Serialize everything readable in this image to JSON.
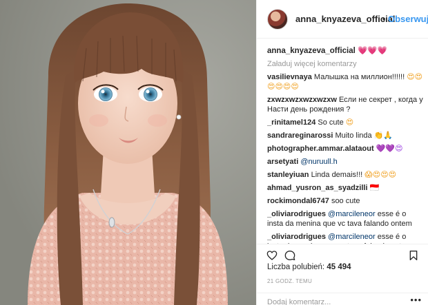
{
  "header": {
    "username": "anna_knyazeva_official",
    "separator": "•",
    "follow_label": "Obserwuj"
  },
  "caption": {
    "username": "anna_knyazeva_official",
    "text": "💗💗💗"
  },
  "load_more_label": "Załaduj więcej komentarzy",
  "comments": [
    {
      "username": "vasilievnaya",
      "text": "Малышка на миллион!!!!!!",
      "emoji": "😍😍😍😍😍😍"
    },
    {
      "username": "zxwzxwzxwzxwzxw",
      "text": "Если не секрет , когда у Насти день рождения ?",
      "emoji": ""
    },
    {
      "username": "_rinitamel124",
      "text": "So cute",
      "emoji": "😍"
    },
    {
      "username": "sandrareginarossi",
      "text": "Muito linda",
      "emoji": "👏🙏"
    },
    {
      "username": "photographer.ammar.alataout",
      "text": "",
      "emoji": "💜💜😍"
    },
    {
      "username": "arsetyati",
      "mention": "@nuruull.h",
      "text": "",
      "emoji": ""
    },
    {
      "username": "stanleyiuan",
      "text": "Linda demais!!!",
      "emoji": "😱😍😍😍"
    },
    {
      "username": "ahmad_yusron_as_syadzilli",
      "text": "",
      "emoji": "🇮🇩"
    },
    {
      "username": "rockimondal6747",
      "text": "soo cute",
      "emoji": ""
    },
    {
      "username": "_oliviarodrigues",
      "mention": "@marcileneor",
      "text": "esse é o insta da menina que vc tava falando ontem",
      "emoji": ""
    },
    {
      "username": "_oliviarodrigues",
      "mention": "@marcileneor",
      "text": "esse é o insta da menina que vc tava falando ontem",
      "emoji": ""
    }
  ],
  "likes": {
    "label": "Liczba polubień:",
    "count": "45 494"
  },
  "time_ago": "21 GODZ. TEMU",
  "add_comment": {
    "placeholder": "Dodaj komentarz...",
    "more": "•••"
  },
  "icons": {
    "like": "heart-icon",
    "comment": "comment-icon",
    "save": "bookmark-icon",
    "avatar": "profile-avatar"
  },
  "colors": {
    "link": "#3897f0",
    "mention": "#003569",
    "muted": "#999999",
    "text": "#262626",
    "border": "#efefef"
  }
}
